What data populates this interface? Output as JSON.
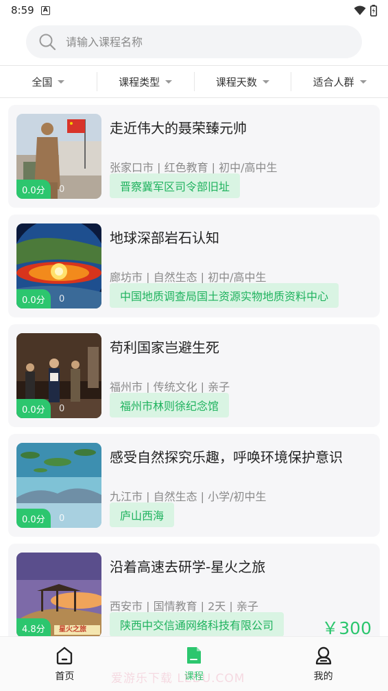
{
  "status_bar": {
    "time": "8:59",
    "notification_icon": "A"
  },
  "search": {
    "placeholder": "请输入课程名称"
  },
  "filters": [
    "全国",
    "课程类型",
    "课程天数",
    "适合人群"
  ],
  "courses": [
    {
      "title": "走近伟大的聂荣臻元帅",
      "meta": "张家口市 | 红色教育  | 初中/高中生",
      "tag": "晋察冀军区司令部旧址",
      "rating": "0.0分",
      "views": "0",
      "price": "",
      "image": "statue-with-flag"
    },
    {
      "title": "地球深部岩石认知",
      "meta": "廊坊市 | 自然生态  | 初中/高中生",
      "tag": "中国地质调查局国土资源实物地质资料中心",
      "rating": "0.0分",
      "views": "0",
      "price": "",
      "image": "earth-core"
    },
    {
      "title": "苟利国家岂避生死",
      "meta": "福州市 | 传统文化  | 亲子",
      "tag": "福州市林则徐纪念馆",
      "rating": "0.0分",
      "views": "0",
      "price": "",
      "image": "museum-figures"
    },
    {
      "title": "感受自然探究乐趣，呼唤环境保护意识",
      "meta": "九江市 | 自然生态  | 小学/初中生",
      "tag": "庐山西海",
      "rating": "0.0分",
      "views": "0",
      "price": "",
      "image": "lake-islands"
    },
    {
      "title": "沿着高速去研学-星火之旅",
      "meta": "西安市 | 国情教育 | 2天 | 亲子",
      "tag": "陕西中交信通网络科技有限公司",
      "rating": "4.8分",
      "views": "",
      "price": "￥300",
      "image": "pavilion-sunset",
      "image_caption": "星火之旅"
    }
  ],
  "tabbar": [
    {
      "label": "首页",
      "icon": "home-icon",
      "active": false
    },
    {
      "label": "课程",
      "icon": "course-icon",
      "active": true
    },
    {
      "label": "我的",
      "icon": "profile-icon",
      "active": false
    }
  ],
  "watermark": "爱游乐下载  LEDU.COM",
  "colors": {
    "accent": "#2cc66e",
    "tag_bg": "#d9f4e3",
    "card_bg": "#f6f6f8"
  }
}
